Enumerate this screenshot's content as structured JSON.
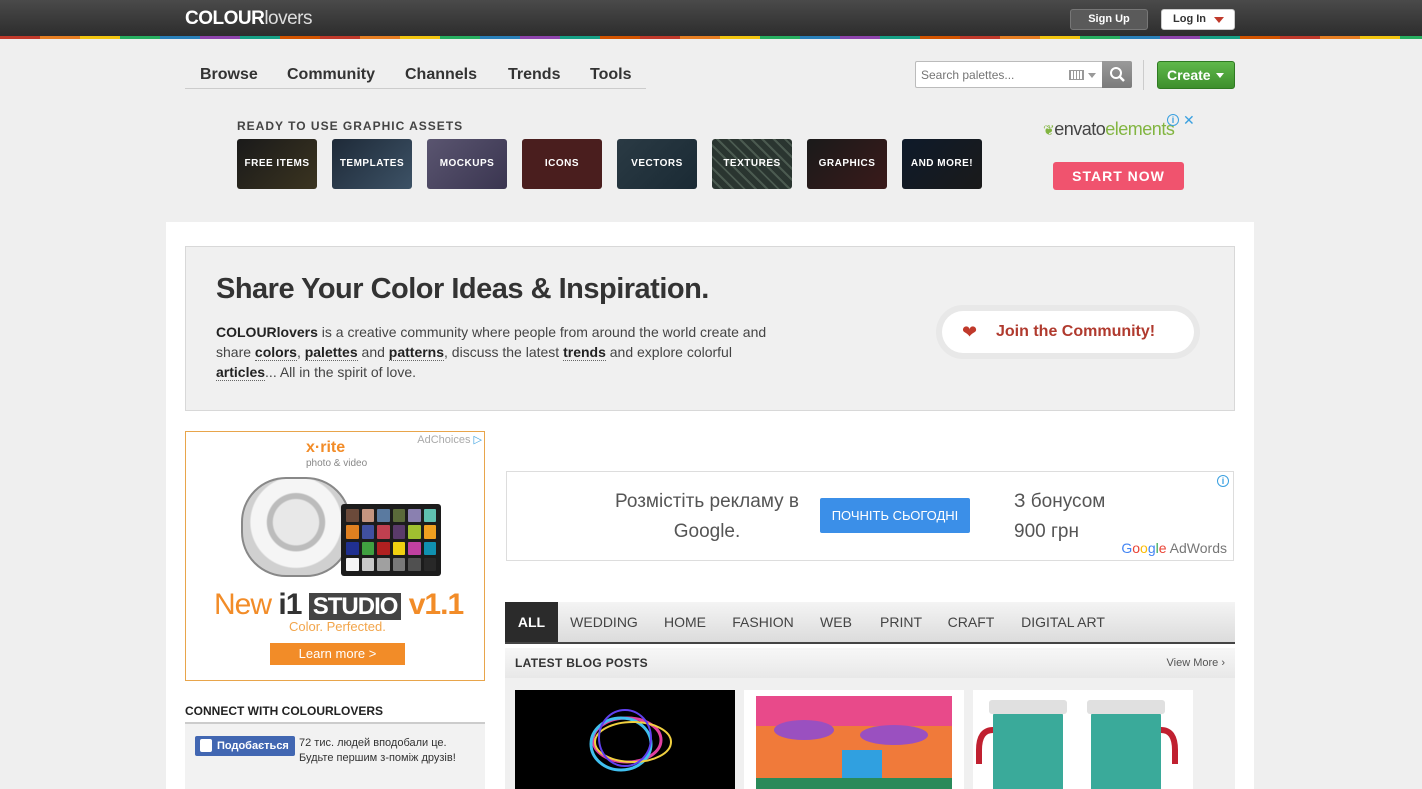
{
  "header": {
    "logo_bold": "COLOUR",
    "logo_light": "lovers",
    "signup_label": "Sign Up",
    "login_label": "Log In"
  },
  "nav": {
    "items": [
      "Browse",
      "Community",
      "Channels",
      "Trends",
      "Tools"
    ]
  },
  "search": {
    "placeholder": "Search palettes..."
  },
  "create_label": "Create",
  "envato_ad": {
    "title": "READY TO USE GRAPHIC ASSETS",
    "tiles": [
      "FREE ITEMS",
      "TEMPLATES",
      "MOCKUPS",
      "ICONS",
      "VECTORS",
      "TEXTURES",
      "GRAPHICS",
      "AND MORE!"
    ],
    "logo_part1": "envato",
    "logo_part2": "elements",
    "cta": "START NOW"
  },
  "hero": {
    "heading": "Share Your Color Ideas & Inspiration.",
    "brand": "COLOURlovers",
    "text1": " is a creative community where people from around the world create and share ",
    "link_colors": "colors",
    "sep1": ", ",
    "link_palettes": "palettes",
    "sep2": " and ",
    "link_patterns": "patterns",
    "text2": ", discuss the latest ",
    "link_trends": "trends",
    "text3": " and explore colorful ",
    "link_articles": "articles",
    "text4": "... All in the spirit of love.",
    "join_label": "Join the Community!"
  },
  "xrite_ad": {
    "adchoices": "AdChoices",
    "logo": "x·rite",
    "sub": "photo & video",
    "new_word": "New ",
    "i1": "i1",
    "studio": "STUDIO",
    "version": " v1.1",
    "tagline": "Color. Perfected.",
    "learn": "Learn more >"
  },
  "google_ad": {
    "left_text": "Розмістіть рекламу в Google.",
    "cta": "ПОЧНІТЬ СЬОГОДНІ",
    "right_text_1": "З бонусом",
    "right_text_2": "900 грн",
    "brand_adwords": " AdWords"
  },
  "connect": {
    "title": "CONNECT WITH COLOURLOVERS",
    "like_label": "Подобається",
    "like_text": "72 тис. людей вподобали це. Будьте першим з-поміж друзів!"
  },
  "tabs": [
    "ALL",
    "WEDDING",
    "HOME",
    "FASHION",
    "WEB",
    "PRINT",
    "CRAFT",
    "DIGITAL ART"
  ],
  "blog": {
    "title": "LATEST BLOG POSTS",
    "view_more": "View More ›"
  }
}
